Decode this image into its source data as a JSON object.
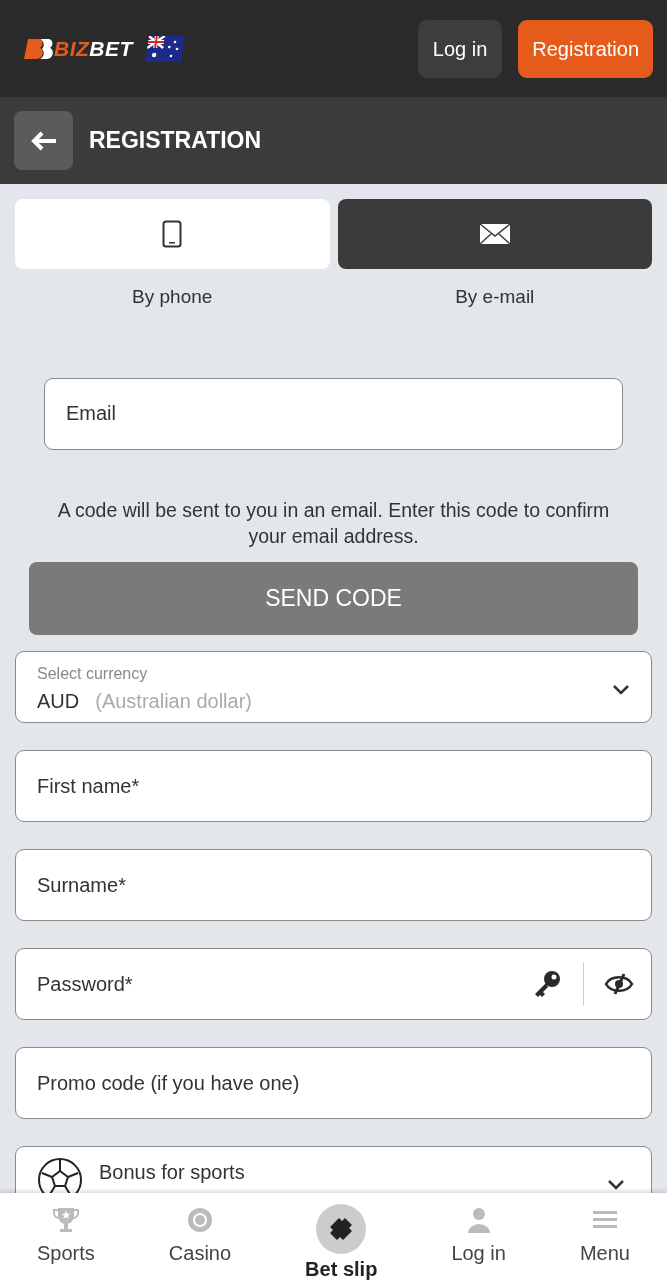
{
  "header": {
    "logo": {
      "part_1": "BIZ",
      "part_2": "BET"
    },
    "login_button": "Log in",
    "register_button": "Registration"
  },
  "page_title": "REGISTRATION",
  "methods": [
    {
      "label": "By phone",
      "kind": "phone",
      "selected": false
    },
    {
      "label": "By e-mail",
      "kind": "email",
      "selected": true
    }
  ],
  "email_field": {
    "placeholder": "Email"
  },
  "hint": "A code will be sent to you in an email. Enter this code to confirm your email address.",
  "send_code_button": {
    "label": "SEND CODE",
    "disabled": true
  },
  "currency": {
    "label": "Select currency",
    "code": "AUD",
    "name": "(Australian dollar)"
  },
  "fields": [
    {
      "placeholder": "First name*",
      "kind": "text"
    },
    {
      "placeholder": "Surname*",
      "kind": "text"
    },
    {
      "placeholder": "Password*",
      "kind": "password"
    },
    {
      "placeholder": "Promo code (if you have one)",
      "kind": "text"
    }
  ],
  "bonus": {
    "title": "Bonus for sports"
  },
  "bottom_nav": [
    {
      "label": "Sports",
      "kind": "trophy",
      "selected": false
    },
    {
      "label": "Casino",
      "kind": "chip",
      "selected": false
    },
    {
      "label": "Bet slip",
      "kind": "ticket",
      "selected": true
    },
    {
      "label": "Log in",
      "kind": "person",
      "selected": false
    },
    {
      "label": "Menu",
      "kind": "menu",
      "selected": false
    }
  ]
}
